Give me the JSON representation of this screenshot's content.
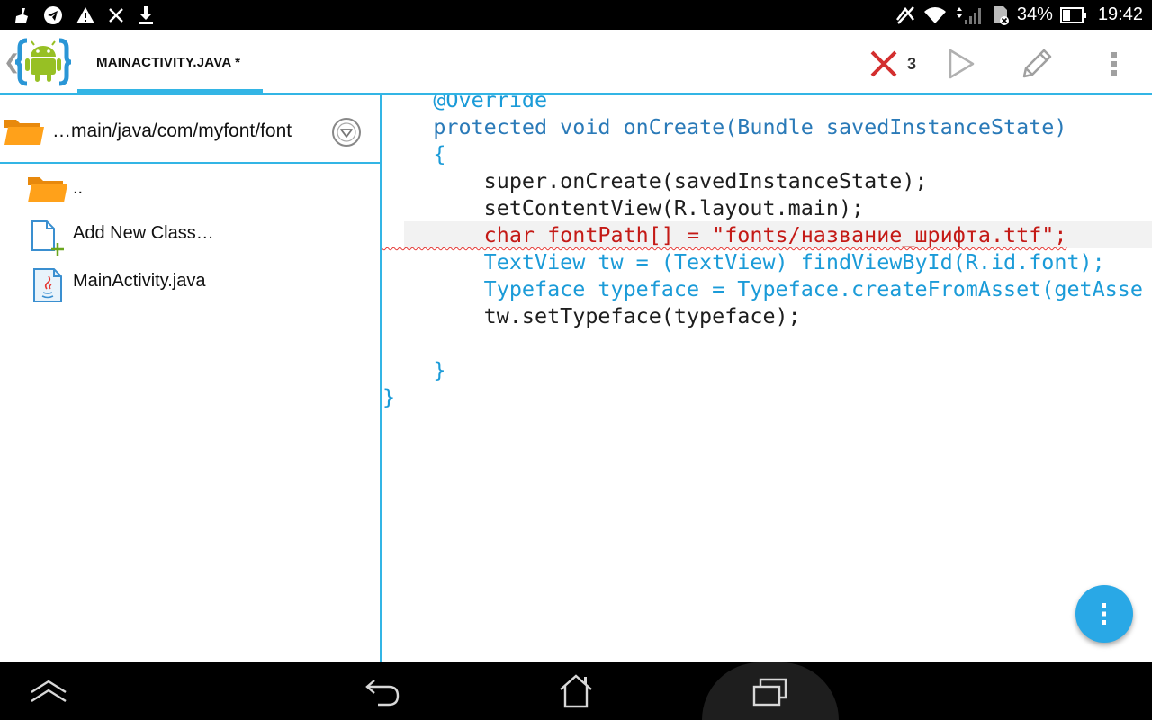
{
  "status_bar": {
    "battery_percent": "34%",
    "time": "19:42",
    "left_icons": [
      "broom-icon",
      "telegram-icon",
      "warning-icon",
      "close-icon",
      "download-icon"
    ],
    "right_icons": [
      "mute-icon",
      "wifi-icon",
      "signal-icon",
      "sd-card-icon",
      "battery-icon"
    ]
  },
  "action_bar": {
    "tab_label": "MAINACTIVITY.JAVA *",
    "error_count": "3",
    "icons": [
      "android-logo-icon",
      "error-x-icon",
      "play-icon",
      "pencil-icon",
      "overflow-menu-icon"
    ]
  },
  "sidebar": {
    "path": "…main/java/com/myfont/font",
    "items": [
      {
        "label": "..",
        "icon": "folder-icon"
      },
      {
        "label": "Add New Class…",
        "icon": "add-file-icon"
      },
      {
        "label": "MainActivity.java",
        "icon": "java-file-icon"
      }
    ]
  },
  "editor": {
    "lines": [
      "    @Override",
      "    protected void onCreate(Bundle savedInstanceState)",
      "    {",
      "        super.onCreate(savedInstanceState);",
      "        setContentView(R.layout.main);",
      "        char fontPath[] = \"fonts/название_шрифта.ttf\";",
      "        TextView tw = (TextView) findViewById(R.id.font);",
      "        Typeface typeface = Typeface.createFromAsset(getAsse",
      "        tw.setTypeface(typeface);",
      "",
      "    }",
      "}"
    ],
    "current_line_index": 5,
    "colors": {
      "keyword": "#2a7ab8",
      "type": "#1b9bd8",
      "string": "#c41a16",
      "error_underline": "#e53935",
      "accent": "#33b5e5"
    }
  },
  "fab": {
    "icon": "vertical-dots-icon"
  },
  "nav_bar": {
    "icons": [
      "app-up-icon",
      "back-icon",
      "home-icon",
      "recent-apps-icon"
    ]
  }
}
